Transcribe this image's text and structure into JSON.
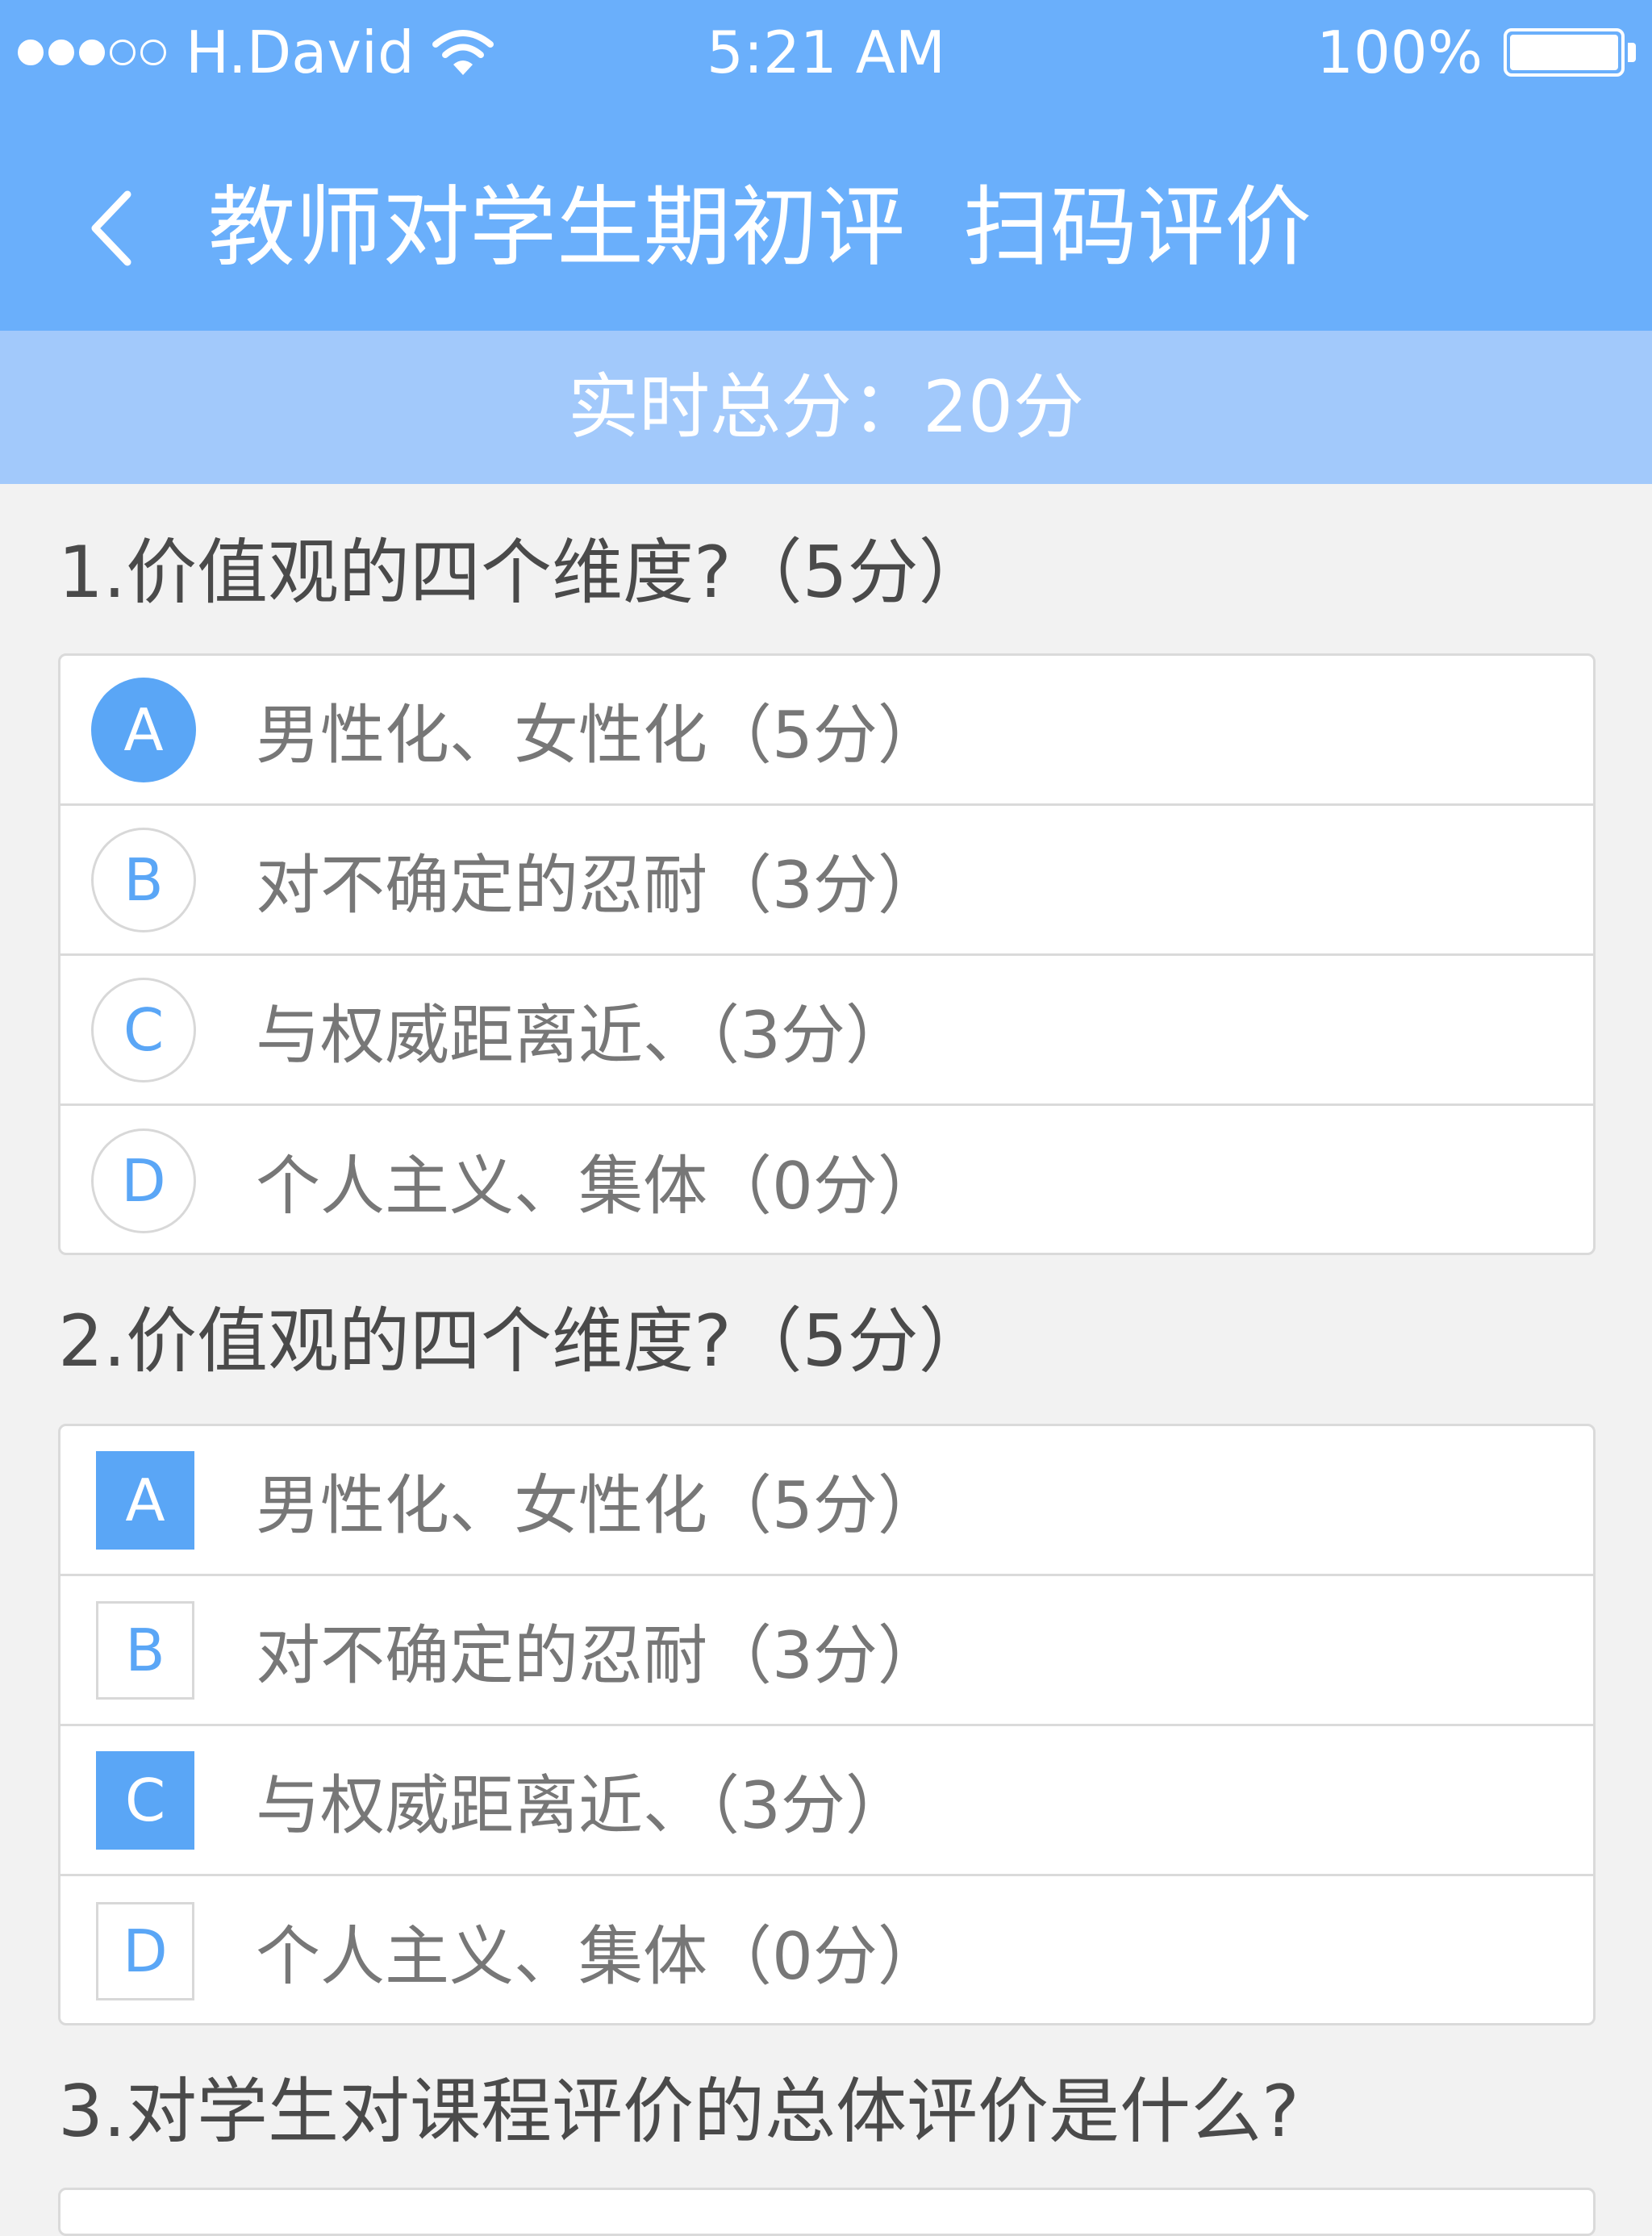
{
  "status_bar": {
    "signal_dots_filled": 3,
    "signal_dots_total": 5,
    "carrier": "H.David",
    "time": "5:21 AM",
    "battery": "100%",
    "battery_level": 1.0
  },
  "nav": {
    "title": "教师对学生期初评",
    "subtitle": "扫码评价"
  },
  "score": {
    "text": "实时总分：20分"
  },
  "questions": [
    {
      "title": "1.价值观的四个维度?（5分）",
      "style": "radio",
      "options": [
        {
          "letter": "A",
          "text": "男性化、女性化（5分）",
          "selected": true
        },
        {
          "letter": "B",
          "text": "对不确定的忍耐（3分）",
          "selected": false
        },
        {
          "letter": "C",
          "text": "与权威距离近、（3分）",
          "selected": false
        },
        {
          "letter": "D",
          "text": "个人主义、集体（0分）",
          "selected": false
        }
      ]
    },
    {
      "title": "2.价值观的四个维度?（5分）",
      "style": "checkbox",
      "options": [
        {
          "letter": "A",
          "text": "男性化、女性化（5分）",
          "selected": true
        },
        {
          "letter": "B",
          "text": "对不确定的忍耐（3分）",
          "selected": false
        },
        {
          "letter": "C",
          "text": "与权威距离近、（3分）",
          "selected": true
        },
        {
          "letter": "D",
          "text": "个人主义、集体（0分）",
          "selected": false
        }
      ]
    },
    {
      "title": "3.对学生对课程评价的总体评价是什么?"
    }
  ],
  "colors": {
    "nav_bg": "#6aaffb",
    "score_bg": "#a2c9fb",
    "accent": "#5aa6f6",
    "page_bg": "#f2f2f2"
  }
}
